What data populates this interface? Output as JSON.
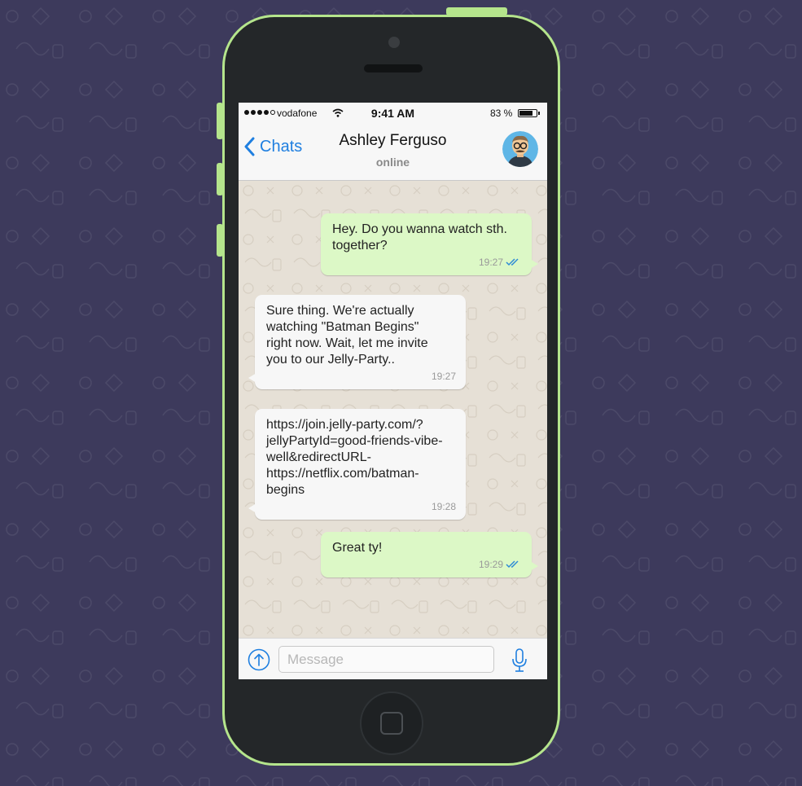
{
  "status_bar": {
    "carrier": "vodafone",
    "time": "9:41 AM",
    "battery_percent": "83 %",
    "battery_level": 0.83,
    "signal_bars": 4
  },
  "nav": {
    "back_label": "Chats",
    "contact_name": "Ashley Ferguso",
    "contact_status": "online"
  },
  "messages": [
    {
      "direction": "outgoing",
      "text": "Hey. Do you wanna watch sth.\ntogether?",
      "time": "19:27",
      "read": true
    },
    {
      "direction": "incoming",
      "text": "Sure thing. We're actually\nwatching \"Batman Begins\"\nright now. Wait, let me invite\nyou to our Jelly-Party..",
      "time": "19:27"
    },
    {
      "direction": "incoming",
      "text": "https://join.jelly-party.com/?\njellyPartyId=good-friends-vibe-\nwell&redirectURL-\nhttps://netflix.com/batman-\nbegins",
      "time": "19:28"
    },
    {
      "direction": "outgoing",
      "text": "Great ty!",
      "time": "19:29",
      "read": true
    }
  ],
  "input": {
    "placeholder": "Message",
    "value": ""
  },
  "colors": {
    "accent": "#1f7fe0",
    "outgoing_bubble": "#dcf8c6",
    "incoming_bubble": "#f7f7f7",
    "phone_frame": "#b5e58c",
    "background": "#3d3a5c",
    "read_ticks": "#2e8bd6"
  },
  "icons": {
    "back": "chevron-left-icon",
    "wifi": "wifi-icon",
    "battery": "battery-icon",
    "attach": "upload-arrow-icon",
    "mic": "microphone-icon",
    "read": "double-check-icon"
  }
}
